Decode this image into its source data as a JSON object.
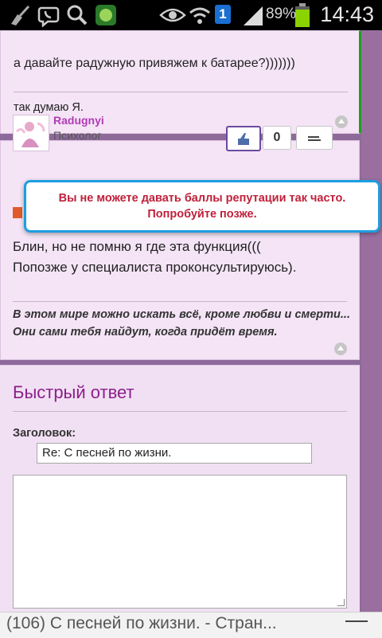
{
  "status": {
    "battery": "89%",
    "time": "14:43",
    "notification_count": "1"
  },
  "post1": {
    "text": "а давайте радужную привяжем к батарее?)))))))",
    "signature": "так думаю Я."
  },
  "post2": {
    "username": "Radugnyi",
    "role": "Психолог",
    "reputation": "0",
    "line1": "Блин, но не помню я где эта функция(((",
    "line2": "Попозже у специалиста проконсультируюсь).",
    "sig1": "В этом мире можно искать всё, кроме любви и смерти...",
    "sig2": "Они сами тебя найдут, когда придёт время."
  },
  "toast": {
    "line1": "Вы не можете давать баллы репутации так часто.",
    "line2": "Попробуйте позже."
  },
  "quick_reply": {
    "title": "Быстрый ответ",
    "label": "Заголовок:",
    "subject_value": "Re: С песней по жизни."
  },
  "bottom": {
    "page_title": "(106) С песней по жизни. - Стран..."
  },
  "colors": {
    "accent": "#8b1f8c",
    "toast_border": "#1e9ee0",
    "toast_text": "#c0203a",
    "username": "#b13bb5"
  }
}
